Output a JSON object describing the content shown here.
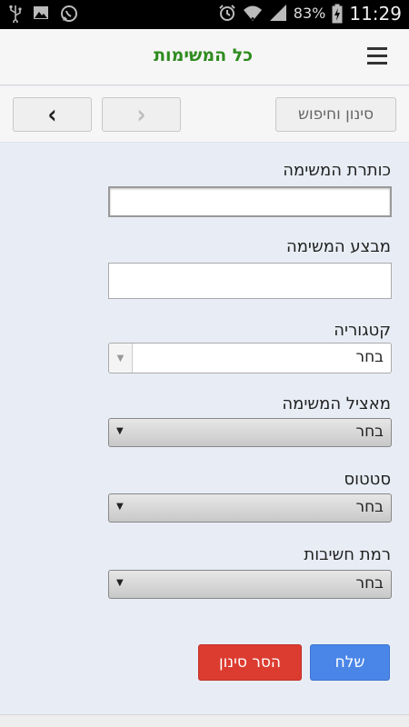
{
  "status_bar": {
    "icons_left": [
      "usb-icon",
      "image-icon",
      "whatsapp-icon"
    ],
    "icons_right": [
      "alarm-icon",
      "wifi-icon",
      "signal-icon",
      "battery-charging-icon"
    ],
    "battery": "83%",
    "time": "11:29"
  },
  "header": {
    "title": "כל המשימות",
    "menu_icon": "hamburger-icon",
    "title_color": "#2e8b1f"
  },
  "toolbar": {
    "filter_label": "סינון וחיפוש",
    "forward_icon": "chevron-right-icon",
    "back_icon": "chevron-left-icon"
  },
  "form": {
    "title_label": "כותרת המשימה",
    "title_value": "",
    "executor_label": "מבצע המשימה",
    "executor_value": "",
    "category_label": "קטגוריה",
    "category_value": "בחר",
    "assigner_label": "מאציל המשימה",
    "assigner_value": "בחר",
    "status_label": "סטטוס",
    "status_value": "בחר",
    "priority_label": "רמת חשיבות",
    "priority_value": "בחר",
    "send_label": "שלח",
    "clear_label": "הסר סינון"
  },
  "colors": {
    "send": "#4a86e8",
    "clear": "#dc3c30",
    "background": "#e8edf5"
  }
}
